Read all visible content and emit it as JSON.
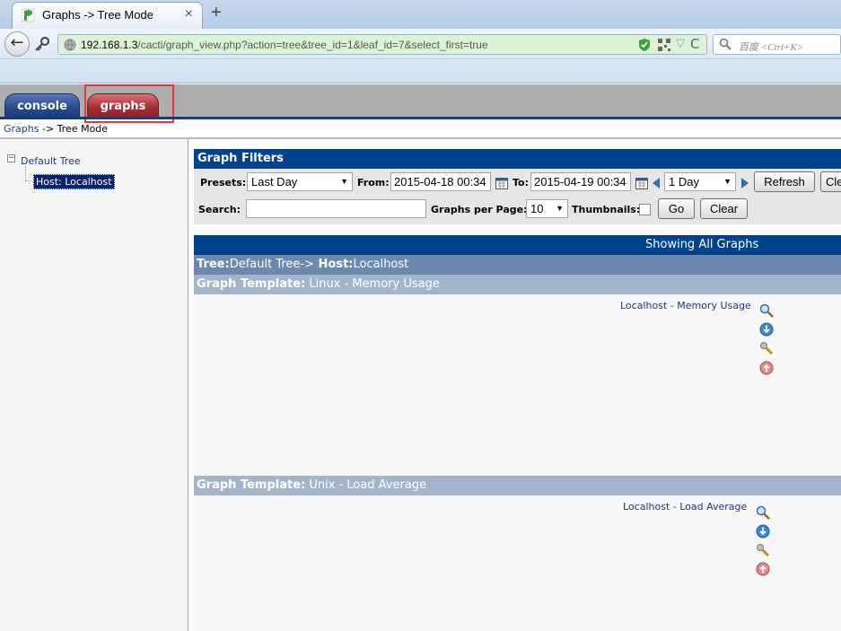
{
  "browser": {
    "tab_title": "Graphs -> Tree Mode",
    "tab_close": "×",
    "new_tab": "+",
    "back": "←",
    "url_host": "192.168.1.3",
    "url_path": "/cacti/graph_view.php?action=tree&tree_id=1&leaf_id=7&select_first=true",
    "search_placeholder": "百度 <Ctrl+K>",
    "star": "▽",
    "reload": "C"
  },
  "cacti_tabs": {
    "console": "console",
    "graphs": "graphs"
  },
  "breadcrumb": {
    "link": "Graphs",
    "rest": " -> Tree Mode"
  },
  "tree": {
    "toggle": "−",
    "root": "Default Tree",
    "leaf": "Host: Localhost"
  },
  "filters": {
    "title": "Graph Filters",
    "presets_label": "Presets:",
    "presets_value": "Last Day",
    "from_label": "From:",
    "from_value": "2015-04-18 00:34",
    "to_label": "To:",
    "to_value": "2015-04-19 00:34",
    "span_value": "1 Day",
    "refresh": "Refresh",
    "clear_top": "Clear",
    "search_label": "Search:",
    "search_value": "",
    "gpp_label": "Graphs per Page:",
    "gpp_value": "10",
    "thumbs_label": "Thumbnails:",
    "go": "Go",
    "clear": "Clear",
    "caret": "▼"
  },
  "graphs": {
    "showing": "Showing All Graphs",
    "tree_prefix": "Tree:",
    "tree_name": "Default Tree->",
    "host_prefix": " Host:",
    "host_name": "Localhost",
    "templates": [
      {
        "prefix": "Graph Template:",
        "name": " Linux - Memory Usage",
        "link": "Localhost - Memory Usage"
      },
      {
        "prefix": "Graph Template:",
        "name": " Unix - Load Average",
        "link": "Localhost - Load Average"
      }
    ]
  }
}
